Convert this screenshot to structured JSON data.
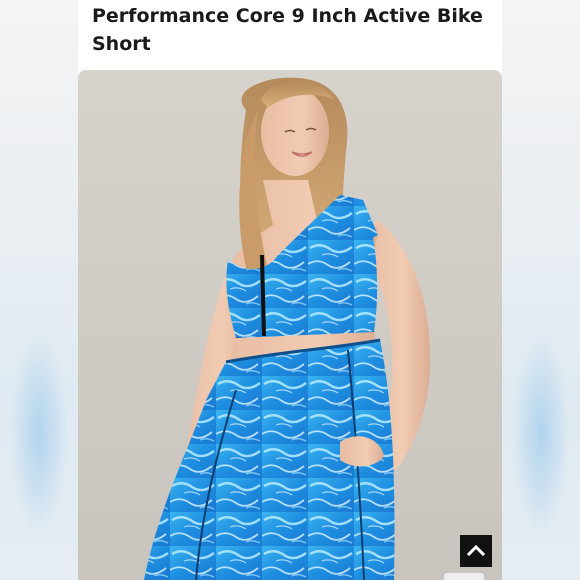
{
  "product": {
    "title_line1": "Performance Core 9 Inch Active Bike",
    "title_line2": "Short"
  },
  "photo": {
    "subject": "product-photo"
  },
  "controls": {
    "scroll_top_icon": "chevron-up-icon"
  },
  "colors": {
    "pattern_primary": "#1e8ee0",
    "pattern_highlight": "#b8ecff",
    "backdrop": "#d6d2cc",
    "button": "#111111"
  }
}
